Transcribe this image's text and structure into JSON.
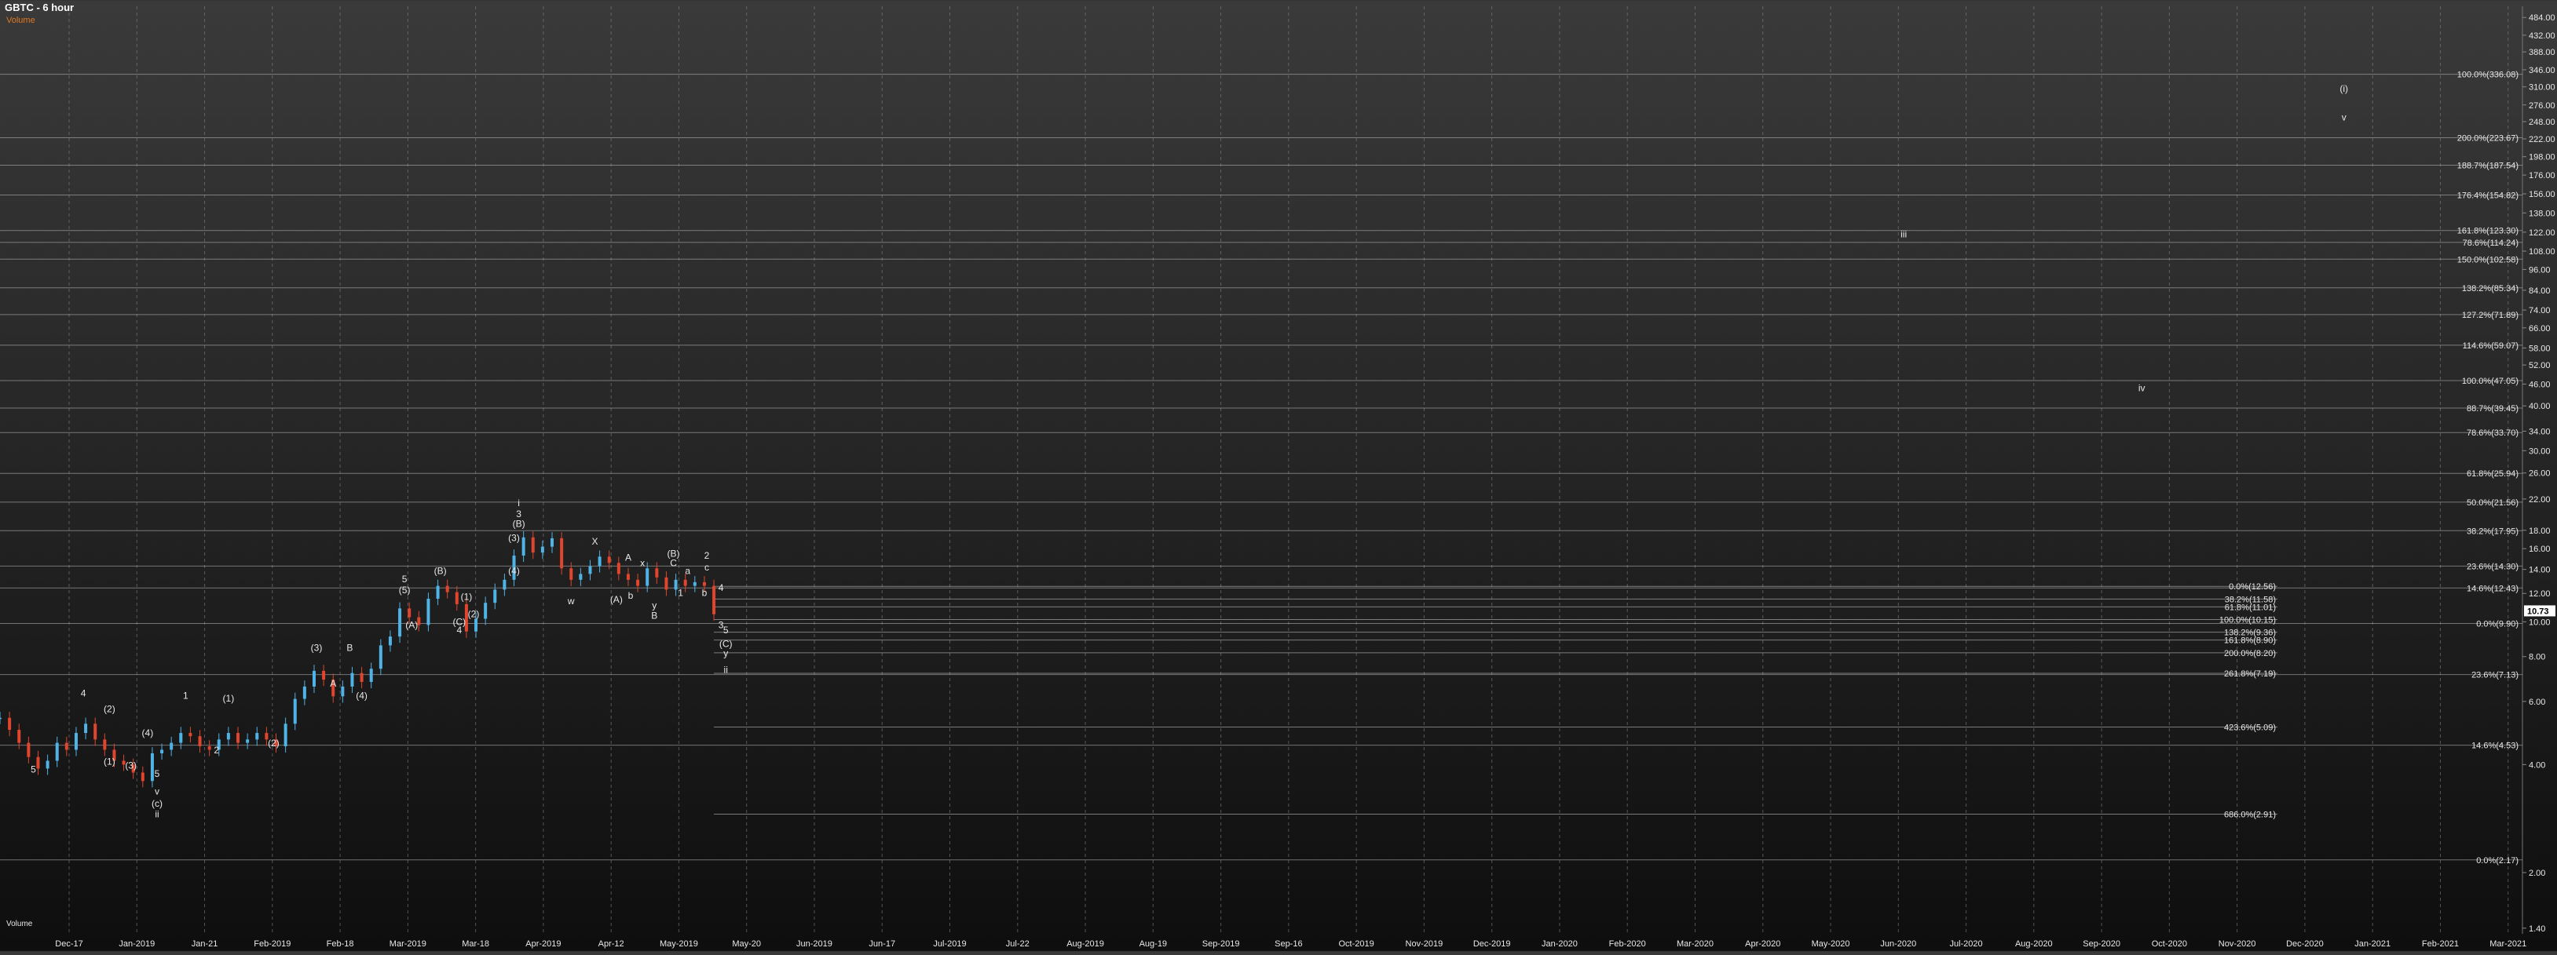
{
  "header": {
    "title": "GBTC - 6 hour",
    "subtitle": "Volume"
  },
  "volume_label": "Volume",
  "colors": {
    "up": "#4fb3e6",
    "down": "#e0452e",
    "grid": "#8a8a8a",
    "fib": "#bdbdbd",
    "text": "#e8e8e8"
  },
  "chart_data": {
    "type": "line",
    "title": "GBTC - 6 hour",
    "xlabel": "",
    "ylabel": "",
    "y_scale": "log",
    "ylim": [
      1.35,
      520
    ],
    "x_ticks": [
      "Dec-17",
      "Jan-2019",
      "Jan-21",
      "Feb-2019",
      "Feb-18",
      "Mar-2019",
      "Mar-18",
      "Apr-2019",
      "Apr-12",
      "May-2019",
      "May-20",
      "Jun-2019",
      "Jun-17",
      "Jul-2019",
      "Jul-22",
      "Aug-2019",
      "Aug-19",
      "Sep-2019",
      "Sep-16",
      "Oct-2019",
      "Nov-2019",
      "Dec-2019",
      "Jan-2020",
      "Feb-2020",
      "Mar-2020",
      "Apr-2020",
      "May-2020",
      "Jun-2020",
      "Jul-2020",
      "Aug-2020",
      "Sep-2020",
      "Oct-2020",
      "Nov-2020",
      "Dec-2020",
      "Jan-2021",
      "Feb-2021",
      "Mar-2021"
    ],
    "y_ticks": [
      "484.00",
      "432.00",
      "388.00",
      "346.00",
      "310.00",
      "276.00",
      "248.00",
      "222.00",
      "198.00",
      "176.00",
      "156.00",
      "138.00",
      "122.00",
      "108.00",
      "96.00",
      "84.00",
      "74.00",
      "66.00",
      "58.00",
      "52.00",
      "46.00",
      "40.00",
      "34.00",
      "30.00",
      "26.00",
      "22.00",
      "18.00",
      "16.00",
      "14.00",
      "12.00",
      "10.00",
      "8.00",
      "6.00",
      "4.00",
      "2.00",
      "1.40"
    ],
    "last_price": "10.73",
    "series": [
      {
        "x": [
          0,
          4,
          8,
          12,
          16,
          20,
          24,
          28,
          32,
          36,
          40,
          44,
          48,
          52,
          56,
          60,
          64,
          68,
          72,
          76,
          80,
          84,
          88,
          92,
          96,
          100,
          104,
          108,
          112,
          116,
          120,
          124,
          128,
          132,
          136,
          140,
          144,
          148,
          152,
          156,
          160,
          164,
          168,
          172,
          176,
          180,
          184,
          188,
          192,
          196,
          200,
          204,
          208,
          212,
          216,
          220,
          224,
          228,
          232,
          236,
          240,
          244,
          248,
          252,
          256,
          260,
          264,
          268,
          272,
          276,
          280,
          284,
          288,
          292,
          296,
          300
        ],
        "values": [
          5.4,
          5.0,
          4.6,
          4.2,
          3.9,
          4.1,
          4.6,
          4.4,
          4.9,
          5.2,
          4.7,
          4.4,
          4.1,
          4.0,
          3.8,
          3.6,
          4.3,
          4.4,
          4.6,
          4.9,
          4.8,
          4.5,
          4.4,
          4.7,
          4.9,
          4.6,
          4.7,
          4.9,
          4.7,
          4.5,
          5.2,
          6.1,
          6.6,
          7.3,
          6.9,
          6.2,
          6.6,
          7.2,
          6.8,
          7.4,
          8.6,
          9.1,
          10.9,
          10.3,
          9.8,
          11.6,
          12.6,
          12.1,
          11.2,
          9.4,
          10.2,
          11.3,
          12.3,
          13.1,
          15.3,
          17.2,
          15.6,
          16.2,
          17.1,
          14.1,
          13.1,
          13.6,
          14.3,
          15.2,
          14.6,
          13.6,
          13.1,
          12.6,
          14.1,
          13.3,
          12.3,
          13.1,
          12.6,
          12.9,
          12.6,
          10.5
        ]
      }
    ],
    "fib_levels": [
      {
        "label": "100.0%(336.08)",
        "value": 336.08
      },
      {
        "label": "200.0%(223.67)",
        "value": 223.67
      },
      {
        "label": "188.7%(187.54)",
        "value": 187.54
      },
      {
        "label": "176.4%(154.82)",
        "value": 154.82
      },
      {
        "label": "161.8%(123.30)",
        "value": 123.3
      },
      {
        "label": "78.6%(114.24)",
        "value": 114.24
      },
      {
        "label": "150.0%(102.58)",
        "value": 102.58
      },
      {
        "label": "138.2%(85.34)",
        "value": 85.34
      },
      {
        "label": "127.2%(71.89)",
        "value": 71.89
      },
      {
        "label": "114.6%(59.07)",
        "value": 59.07
      },
      {
        "label": "100.0%(47.05)",
        "value": 47.05
      },
      {
        "label": "88.7%(39.45)",
        "value": 39.45
      },
      {
        "label": "78.6%(33.70)",
        "value": 33.7
      },
      {
        "label": "61.8%(25.94)",
        "value": 25.94
      },
      {
        "label": "50.0%(21.56)",
        "value": 21.56
      },
      {
        "label": "38.2%(17.95)",
        "value": 17.95
      },
      {
        "label": "23.6%(14.30)",
        "value": 14.3
      },
      {
        "label": "14.6%(12.43)",
        "value": 12.43
      },
      {
        "label": "0.0%(9.90)",
        "value": 9.9
      },
      {
        "label": "23.6%(7.13)",
        "value": 7.13
      },
      {
        "label": "14.6%(4.53)",
        "value": 4.53
      },
      {
        "label": "0.0%(2.17)",
        "value": 2.17
      }
    ],
    "inner_fib_levels": [
      {
        "label": "0.0%(12.56)",
        "value": 12.56
      },
      {
        "label": "38.2%(11.58)",
        "value": 11.58
      },
      {
        "label": "61.8%(11.01)",
        "value": 11.01
      },
      {
        "label": "100.0%(10.15)",
        "value": 10.15
      },
      {
        "label": "138.2%(9.36)",
        "value": 9.36
      },
      {
        "label": "161.8%(8.90)",
        "value": 8.9
      },
      {
        "label": "200.0%(8.20)",
        "value": 8.2
      },
      {
        "label": "261.8%(7.19)",
        "value": 7.19
      },
      {
        "label": "423.6%(5.09)",
        "value": 5.09
      },
      {
        "label": "686.0%(2.91)",
        "value": 2.91
      }
    ],
    "wave_labels": [
      {
        "text": "(i)",
        "x": 985,
        "value": 300
      },
      {
        "text": "v",
        "x": 985,
        "value": 250
      },
      {
        "text": "iii",
        "x": 800,
        "value": 118
      },
      {
        "text": "iv",
        "x": 900,
        "value": 44
      },
      {
        "text": "i",
        "x": 218,
        "value": 21
      },
      {
        "text": "3",
        "x": 218,
        "value": 19.6
      },
      {
        "text": "(B)",
        "x": 218,
        "value": 18.4
      },
      {
        "text": "(3)",
        "x": 216,
        "value": 16.8
      },
      {
        "text": "(4)",
        "x": 216,
        "value": 13.6
      },
      {
        "text": "X",
        "x": 250,
        "value": 16.4
      },
      {
        "text": "(B)",
        "x": 185,
        "value": 13.6
      },
      {
        "text": "(5)",
        "x": 170,
        "value": 12.0
      },
      {
        "text": "5",
        "x": 170,
        "value": 12.9
      },
      {
        "text": "(A)",
        "x": 173,
        "value": 9.6
      },
      {
        "text": "(1)",
        "x": 196,
        "value": 11.5
      },
      {
        "text": "(2)",
        "x": 199,
        "value": 10.3
      },
      {
        "text": "(C)",
        "x": 193,
        "value": 9.8
      },
      {
        "text": "4",
        "x": 193,
        "value": 9.3
      },
      {
        "text": "(3)",
        "x": 133,
        "value": 8.3
      },
      {
        "text": "B",
        "x": 147,
        "value": 8.3
      },
      {
        "text": "A",
        "x": 140,
        "value": 6.6
      },
      {
        "text": "(4)",
        "x": 152,
        "value": 6.1
      },
      {
        "text": "(1)",
        "x": 96,
        "value": 6.0
      },
      {
        "text": "(2)",
        "x": 115,
        "value": 4.5
      },
      {
        "text": "1",
        "x": 78,
        "value": 6.1
      },
      {
        "text": "2",
        "x": 91,
        "value": 4.3
      },
      {
        "text": "4",
        "x": 35,
        "value": 6.2
      },
      {
        "text": "(2)",
        "x": 46,
        "value": 5.6
      },
      {
        "text": "(1)",
        "x": 46,
        "value": 4.0
      },
      {
        "text": "(3)",
        "x": 55,
        "value": 3.9
      },
      {
        "text": "(4)",
        "x": 62,
        "value": 4.8
      },
      {
        "text": "5",
        "x": 66,
        "value": 3.7
      },
      {
        "text": "v",
        "x": 66,
        "value": 3.3
      },
      {
        "text": "(c)",
        "x": 66,
        "value": 3.05
      },
      {
        "text": "ii",
        "x": 66,
        "value": 2.85
      },
      {
        "text": "5",
        "x": 14,
        "value": 3.8
      },
      {
        "text": "A",
        "x": 264,
        "value": 14.8
      },
      {
        "text": "x",
        "x": 270,
        "value": 14.3
      },
      {
        "text": "(A)",
        "x": 259,
        "value": 11.3
      },
      {
        "text": "b",
        "x": 265,
        "value": 11.6
      },
      {
        "text": "w",
        "x": 240,
        "value": 11.2
      },
      {
        "text": "y",
        "x": 275,
        "value": 10.9
      },
      {
        "text": "B",
        "x": 275,
        "value": 10.2
      },
      {
        "text": "(B)",
        "x": 283,
        "value": 15.2
      },
      {
        "text": "C",
        "x": 283,
        "value": 14.3
      },
      {
        "text": "a",
        "x": 289,
        "value": 13.6
      },
      {
        "text": "1",
        "x": 286,
        "value": 11.8
      },
      {
        "text": "b",
        "x": 296,
        "value": 11.8
      },
      {
        "text": "2",
        "x": 297,
        "value": 15.0
      },
      {
        "text": "c",
        "x": 297,
        "value": 13.9
      },
      {
        "text": "4",
        "x": 303,
        "value": 12.2
      },
      {
        "text": "3",
        "x": 303,
        "value": 9.6
      },
      {
        "text": "5",
        "x": 305,
        "value": 9.3
      },
      {
        "text": "(C)",
        "x": 305,
        "value": 8.5
      },
      {
        "text": "y",
        "x": 305,
        "value": 8.0
      },
      {
        "text": "ii",
        "x": 305,
        "value": 7.2
      }
    ]
  }
}
